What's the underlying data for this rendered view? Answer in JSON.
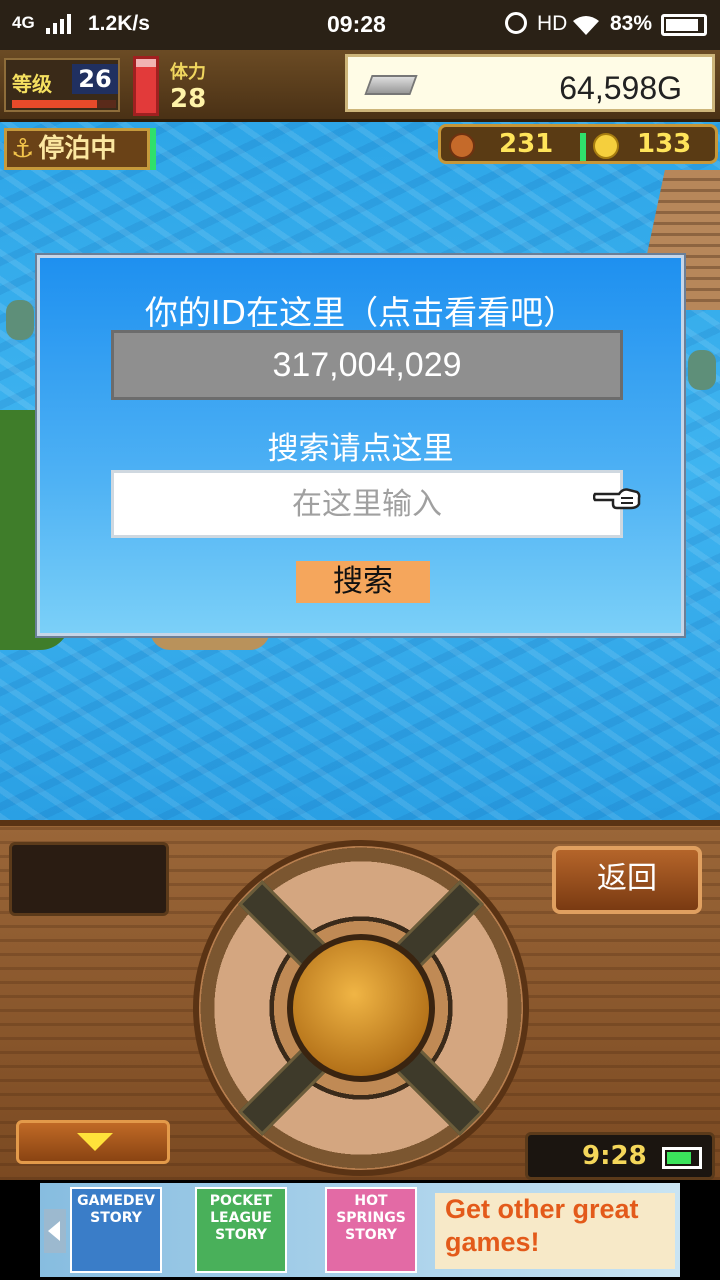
{
  "status_bar": {
    "network": "4G",
    "speed": "1.2K/s",
    "time": "09:28",
    "hd": "HD",
    "battery": "83%"
  },
  "hud": {
    "level_label": "等级",
    "level": "26",
    "level_progress": 0.82,
    "stamina_label": "体力",
    "stamina": "28",
    "stamina_fill": 0.85,
    "gold": "64,598G",
    "status_badge": "停泊中",
    "anchor_icon": "⚓",
    "counter_a": "231",
    "counter_b": "133"
  },
  "dialog": {
    "title": "你的ID在这里（点击看看吧）",
    "id_value": "317,004,029",
    "search_label": "搜索请点这里",
    "search_placeholder": "在这里输入",
    "search_button": "搜索"
  },
  "panel": {
    "back_button": "返回",
    "clock": "9:28",
    "battery_level": 0.7
  },
  "ad": {
    "games": [
      {
        "name": "GAMEDEV STORY"
      },
      {
        "name": "POCKET LEAGUE STORY"
      },
      {
        "name": "HOT SPRINGS STORY"
      }
    ],
    "cta": "Get other great games!"
  },
  "colors": {
    "dialog_blue": "#1e90f0",
    "search_button": "#f5a65c",
    "gold_text": "#ffe45a"
  }
}
